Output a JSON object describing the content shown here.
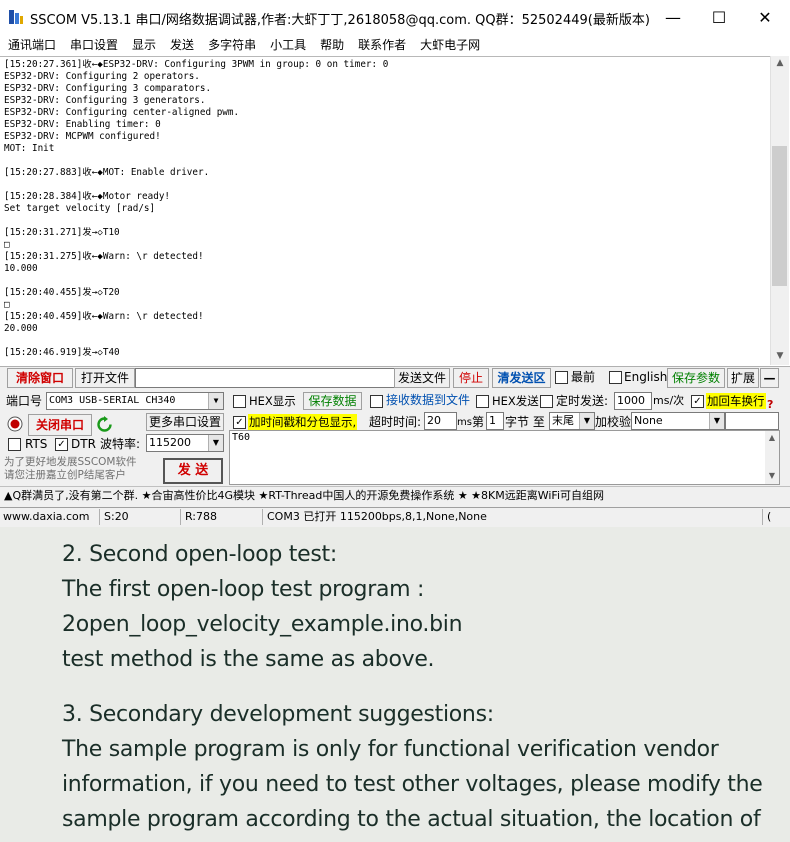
{
  "window": {
    "title": "SSCOM V5.13.1 串口/网络数据调试器,作者:大虾丁丁,2618058@qq.com. QQ群：52502449(最新版本)",
    "minimize": "—",
    "maximize": "☐",
    "close": "✕"
  },
  "menu": [
    "通讯端口",
    "串口设置",
    "显示",
    "发送",
    "多字符串",
    "小工具",
    "帮助",
    "联系作者",
    "大虾电子网"
  ],
  "receive_log": "[15:20:27.361]收←◆ESP32-DRV: Configuring 3PWM in group: 0 on timer: 0\nESP32-DRV: Configuring 2 operators.\nESP32-DRV: Configuring 3 comparators.\nESP32-DRV: Configuring 3 generators.\nESP32-DRV: Configuring center-aligned pwm.\nESP32-DRV: Enabling timer: 0\nESP32-DRV: MCPWM configured!\nMOT: Init\n\n[15:20:27.883]收←◆MOT: Enable driver.\n\n[15:20:28.384]收←◆Motor ready!\nSet target velocity [rad/s]\n\n[15:20:31.271]发→◇T10\n□\n[15:20:31.275]收←◆Warn: \\r detected!\n10.000\n\n[15:20:40.455]发→◇T20\n□\n[15:20:40.459]收←◆Warn: \\r detected!\n20.000\n\n[15:20:46.919]发→◇T40",
  "toolbar": {
    "clear_window": "清除窗口",
    "open_file": "打开文件",
    "file_path": "",
    "send_file": "发送文件",
    "stop": "停止",
    "clear_send": "清发送区",
    "topmost": "最前",
    "english": "English",
    "save_params": "保存参数",
    "expand": "扩展",
    "collapse": "—"
  },
  "panel": {
    "port_label": "端口号",
    "port_value": "COM3 USB-SERIAL CH340",
    "close_port": "关闭串口",
    "more_ports": "更多串口设置",
    "rts": "RTS",
    "dtr": "DTR",
    "baud_label": "波特率:",
    "baud_value": "115200",
    "ad_line1": "为了更好地发展SSCOM软件",
    "ad_line2": "请您注册嘉立创P结尾客户",
    "send_button": "发  送",
    "hex_display": "HEX显示",
    "save_data": "保存数据",
    "recv_to_file": "接收数据到文件",
    "hex_send": "HEX发送",
    "timed_send": "定时发送:",
    "timed_value": "1000",
    "timed_unit": "ms/次",
    "add_crlf": "加回车换行",
    "timestamp": "加时间戳和分包显示,",
    "timeout_label": "超时时间:",
    "timeout_value": "20",
    "timeout_unit": "ms",
    "nth_label": "第",
    "nth_value": "1",
    "byte_label": "字节 至",
    "tail_value": "末尾",
    "checksum_label": "加校验",
    "checksum_value": "None",
    "send_content": "T60"
  },
  "ticker": "▲Q群满员了,没有第二个群. ★合宙高性价比4G模块 ★RT-Thread中国人的开源免费操作系统 ★ ★8KM远距离WiFi可自组网",
  "status": {
    "website": "www.daxia.com",
    "sent": "S:20",
    "received": "R:788",
    "port_state": "COM3 已打开  115200bps,8,1,None,None",
    "tail": "("
  },
  "document": [
    "2. Second open-loop test:",
    "The first open-loop test program :",
    "2open_loop_velocity_example.ino.bin",
    "test method is the same as above.",
    "",
    "3. Secondary development suggestions:",
    "The sample program is only for functional verification vendor",
    "information, if you need to test other voltages, please modify the",
    "sample program according to the actual situation, the location of"
  ],
  "colors": {
    "accent_red": "#d00000",
    "accent_green": "#008000",
    "highlight_yellow": "#ffff00",
    "doc_text": "#1a2e28",
    "doc_bg": "#e9ebe7"
  }
}
